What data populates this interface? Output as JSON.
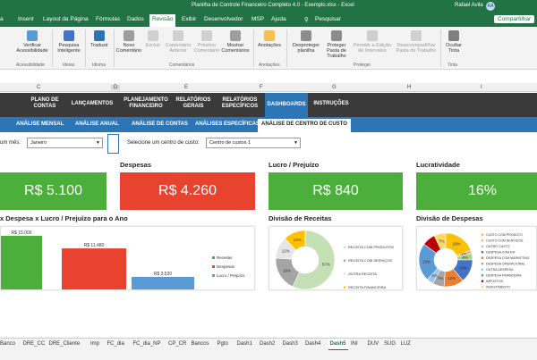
{
  "window": {
    "title": "Planilha de Controle Financeiro Completo 4.0 - Exemplo.xlsx  -  Excel",
    "user": "Rafael Avila",
    "user_initials": "RA"
  },
  "menu": {
    "items": [
      "a",
      "Inserir",
      "Layout da Página",
      "Fórmulas",
      "Dados",
      "Revisão",
      "Exibir",
      "Desenvolvedor",
      "MSP",
      "Ajuda"
    ],
    "search": "Pesquisar",
    "share": "Compartilhar"
  },
  "ribbon": {
    "buttons": [
      {
        "label": "Verificar Acessibilidade"
      },
      {
        "label": "Pesquisa Inteligente"
      },
      {
        "label": "Traduzir"
      },
      {
        "label": "Novo Comentário"
      },
      {
        "label": "Excluir"
      },
      {
        "label": "Comentário Anterior"
      },
      {
        "label": "Próximo Comentário"
      },
      {
        "label": "Mostrar Comentários"
      },
      {
        "label": "Anotações"
      },
      {
        "label": "Desproteger planilha"
      },
      {
        "label": "Proteger Pasta de Trabalho"
      },
      {
        "label": "Permitir a Edição de Intervalos"
      },
      {
        "label": "Desecompartilhar Pasta de Trabalho"
      },
      {
        "label": "Ocultar Tinta"
      }
    ],
    "groups": [
      "Acessibilidade",
      "Ideias",
      "Idioma",
      "Comentários",
      "Anotações",
      "Proteger",
      "Tinta"
    ]
  },
  "columns": [
    "C",
    "D",
    "E",
    "F",
    "G",
    "H",
    "I"
  ],
  "nav": {
    "items": [
      "PLANO DE CONTAS",
      "LANÇAMENTOS",
      "PLANEJAMENTO FINANCEIRO",
      "RELATÓRIOS GERAIS",
      "RELATÓRIOS ESPECÍFICOS",
      "DASHBOARDS",
      "INSTRUÇÕES"
    ],
    "sub": [
      "ANÁLISE MENSAL",
      "ANÁLISE ANUAL",
      "ANÁLISE DE CONTAS",
      "ANÁLISES ESPECÍFICAS",
      "ANÁLISE DE CENTRO DE CUSTO"
    ]
  },
  "filters": {
    "month_label": "um mês:",
    "month_value": "Janeiro",
    "cost_label": "Selecione um centro de custo:",
    "cost_value": "Centro de custos 1"
  },
  "cards": [
    {
      "title": "",
      "value": "R$ 5.100",
      "color": "#4caf3c"
    },
    {
      "title": "Despesas",
      "value": "R$ 4.260",
      "color": "#e8432e"
    },
    {
      "title": "Lucro / Prejuízo",
      "value": "R$ 840",
      "color": "#4caf3c"
    },
    {
      "title": "Lucratividade",
      "value": "16%",
      "color": "#4caf3c"
    }
  ],
  "sections": {
    "bar_title": "x Despesa x Lucro / Prejuízo para o Ano",
    "receitas_title": "Divisão de Receitas",
    "despesas_title": "Divisão de Despesas"
  },
  "chart_data": [
    {
      "type": "bar",
      "title": "x Despesa x Lucro / Prejuízo para o Ano",
      "categories": [
        "Receitas",
        "Despesas",
        "Lucro / Prejuízo"
      ],
      "values": [
        15000,
        11480,
        3520
      ],
      "labels": [
        "R$ 15.000",
        "R$ 11.480",
        "R$ 3.520"
      ],
      "colors": [
        "#4caf3c",
        "#e8432e",
        "#5b9bd5"
      ],
      "ylim": [
        0,
        15000
      ],
      "legend": "right"
    },
    {
      "type": "pie",
      "title": "Divisão de Receitas",
      "labels": [
        "RECEITA COM PRODUTOS",
        "RECEITA COM SERVIÇOS",
        "OUTRA RECEITA",
        "RECEITA FINANCEIRA"
      ],
      "values": [
        57,
        19,
        12,
        12
      ],
      "value_labels": [
        "57%",
        "19%",
        "12%",
        "12%"
      ],
      "colors": [
        "#c5e0b4",
        "#a5a5a5",
        "#e6e6e6",
        "#ffc000"
      ],
      "legend": "right"
    },
    {
      "type": "pie",
      "title": "Divisão de Despesas",
      "labels": [
        "CUSTO COM PRODUTO",
        "CUSTO COM SERVIÇOS",
        "OUTRO CUSTO",
        "DESPESA COM RH",
        "DESPESA COM MARKETING",
        "DESPESA OPERACIONAL",
        "OUTRA DESPESA",
        "DESPESA FINANCEIRA",
        "IMPOSTOS",
        "INVESTIMENTO"
      ],
      "values": [
        19,
        2,
        4,
        14,
        12,
        7,
        4,
        23,
        8,
        7
      ],
      "value_labels": [
        "19%",
        "2%",
        "4%",
        "14%",
        "12%",
        "7%",
        "4%",
        "23%",
        "8%",
        "7%"
      ],
      "colors": [
        "#ffc000",
        "#f4b183",
        "#a9d18e",
        "#4472c4",
        "#ed7d31",
        "#a5a5a5",
        "#9dc3e6",
        "#5b9bd5",
        "#c00000",
        "#ffd966"
      ],
      "legend": "right"
    }
  ],
  "sheet_tabs": [
    "Banco",
    "DRE_CC",
    "DRE_Cliente",
    "Imp",
    "FC_dia",
    "FC_dia_NP",
    "CP_CR",
    "Bancos",
    "Pgto",
    "Dash1",
    "Dash2",
    "Dash3",
    "Dash4",
    "Dash5",
    "INI",
    "DUV",
    "SUG",
    "LUZ"
  ],
  "active_tab": "Dash5"
}
